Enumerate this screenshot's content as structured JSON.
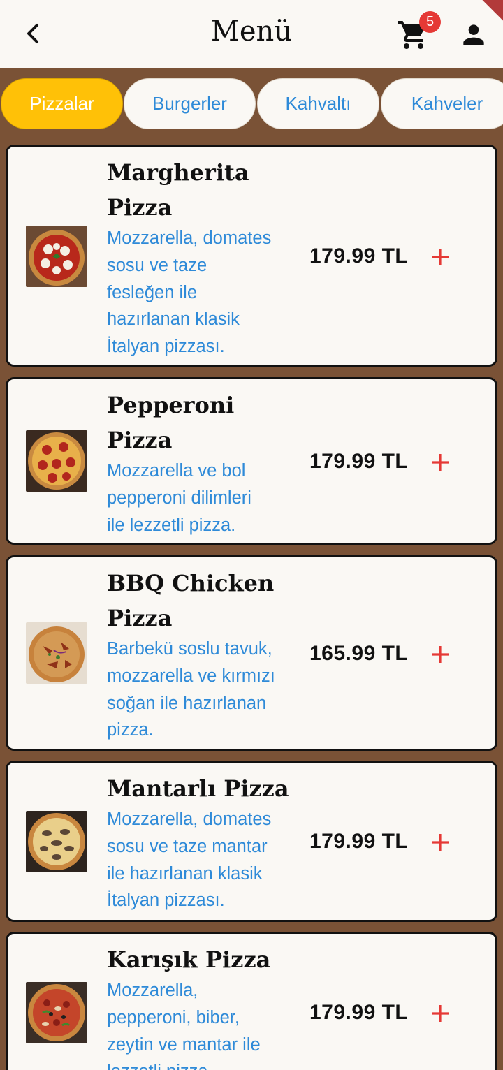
{
  "header": {
    "title": "Menü",
    "cart_count": "5",
    "icons": {
      "back": "back-arrow-icon",
      "cart": "cart-icon",
      "user": "user-icon"
    }
  },
  "categories": [
    {
      "label": "Pizzalar",
      "active": true
    },
    {
      "label": "Burgerler",
      "active": false
    },
    {
      "label": "Kahvaltı",
      "active": false
    },
    {
      "label": "Kahveler",
      "active": false
    }
  ],
  "products": [
    {
      "name_lines": [
        "Margherita",
        "Pizza"
      ],
      "desc_lines": [
        "Mozzarella, domates",
        "sosu ve taze",
        "fesleğen ile",
        "hazırlanan klasik",
        "İtalyan pizzası."
      ],
      "price": "179.99 TL"
    },
    {
      "name_lines": [
        "Pepperoni",
        "Pizza"
      ],
      "desc_lines": [
        "Mozzarella ve bol",
        "pepperoni dilimleri",
        "ile lezzetli pizza."
      ],
      "price": "179.99 TL"
    },
    {
      "name_lines": [
        "BBQ Chicken",
        "Pizza"
      ],
      "desc_lines": [
        "Barbekü soslu tavuk,",
        "mozzarella ve kırmızı",
        "soğan ile hazırlanan",
        "pizza."
      ],
      "price": "165.99 TL"
    },
    {
      "name_lines": [
        "Mantarlı Pizza"
      ],
      "desc_lines": [
        "Mozzarella, domates",
        "sosu ve taze mantar",
        "ile hazırlanan klasik",
        "İtalyan pizzası."
      ],
      "price": "179.99 TL"
    },
    {
      "name_lines": [
        "Karışık Pizza"
      ],
      "desc_lines": [
        "Mozzarella,",
        "pepperoni, biber,",
        "zeytin ve mantar ile",
        "lezzetli pizza."
      ],
      "price": "179.99 TL"
    }
  ],
  "colors": {
    "background": "#7a5236",
    "appbar": "#faf8f4",
    "active_tab": "#ffc107",
    "link_blue": "#2e8ad8",
    "add_red": "#e53935"
  }
}
